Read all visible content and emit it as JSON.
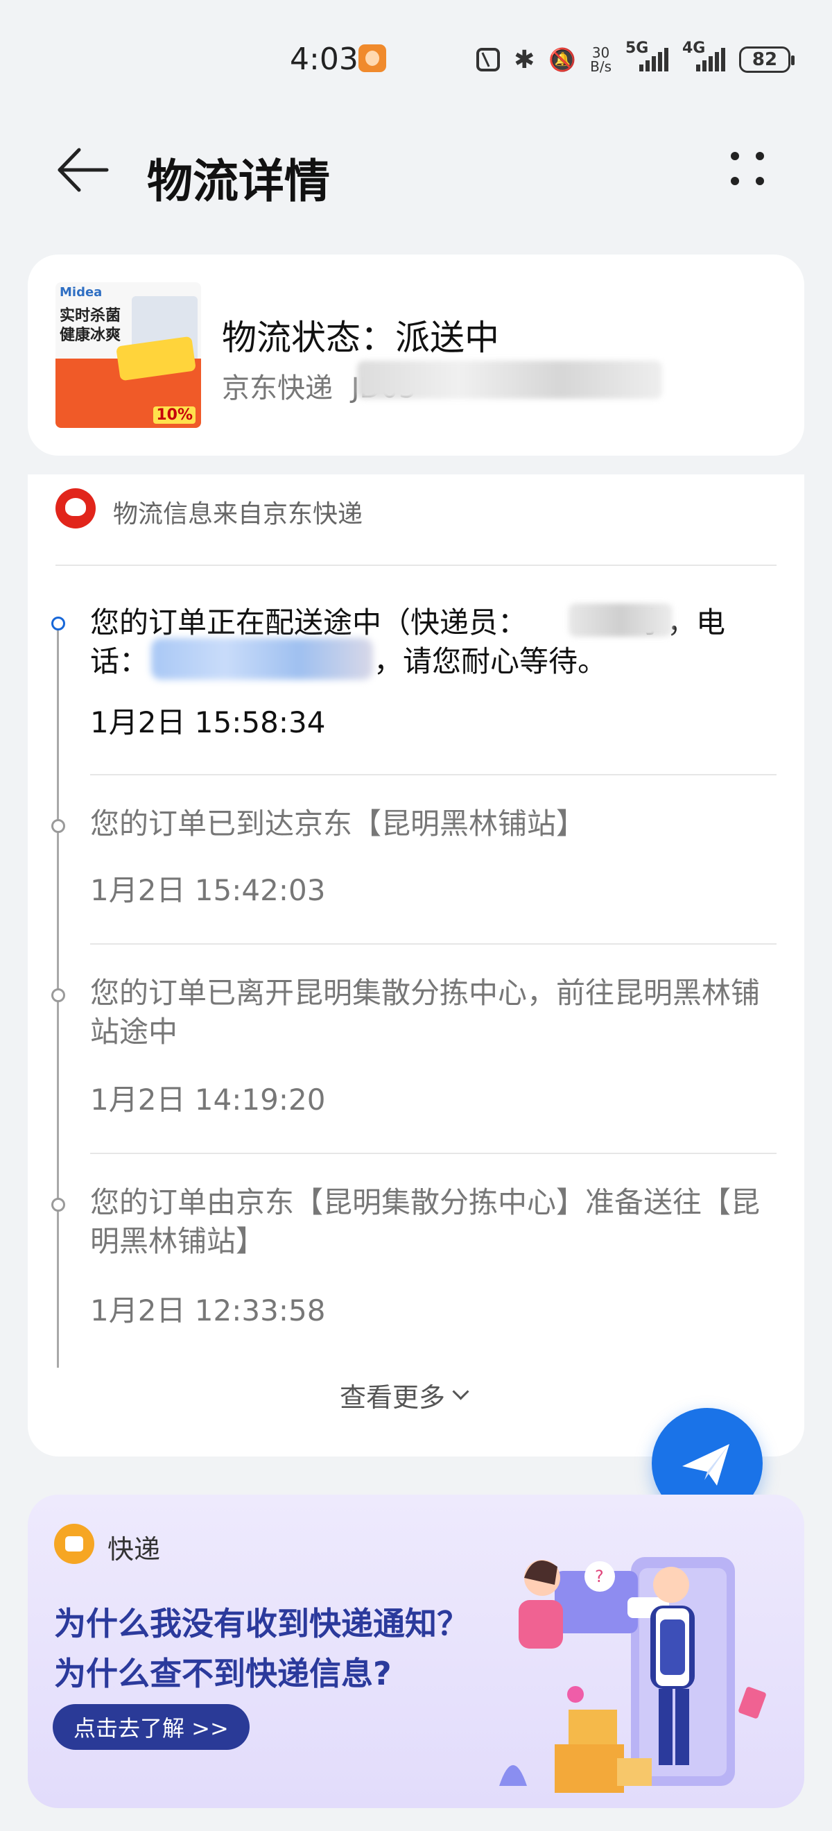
{
  "status_bar": {
    "time": "4:03",
    "net_speed_value": "30",
    "net_speed_unit": "B/s",
    "signal_1": "5G",
    "signal_2": "4G",
    "battery": "82"
  },
  "header": {
    "title": "物流详情"
  },
  "order": {
    "status_label": "物流状态：派送中",
    "carrier": "京东快递",
    "tracking_partial": "JD03",
    "product_image": {
      "brand": "Midea",
      "line1": "实时杀菌",
      "line2": "健康冰爽",
      "badge": "10%"
    }
  },
  "source": {
    "text": "物流信息来自京东快递"
  },
  "timeline": [
    {
      "text": "您的订单正在配送途中（快递员：",
      "text_mid": "宇，电",
      "text2a": "话：",
      "text2b": "，请您耐心等待。",
      "time": "1月2日 15:58:34",
      "active": true
    },
    {
      "text": "您的订单已到达京东【昆明黑林铺站】",
      "time": "1月2日 15:42:03",
      "active": false
    },
    {
      "text": "您的订单已离开昆明集散分拣中心，前往昆明黑林铺站途中",
      "time": "1月2日 14:19:20",
      "active": false
    },
    {
      "text": "您的订单由京东【昆明集散分拣中心】准备送往【昆明黑林铺站】",
      "time": "1月2日 12:33:58",
      "active": false
    }
  ],
  "view_more": "查看更多",
  "promo": {
    "category": "快递",
    "headline1": "为什么我没有收到快递通知？",
    "headline2": "为什么查不到快递信息?",
    "button": "点击去了解 >>"
  },
  "colors": {
    "accent": "#1a73e8",
    "promo_text": "#2b3a9c",
    "jd_red": "#e1251b"
  }
}
